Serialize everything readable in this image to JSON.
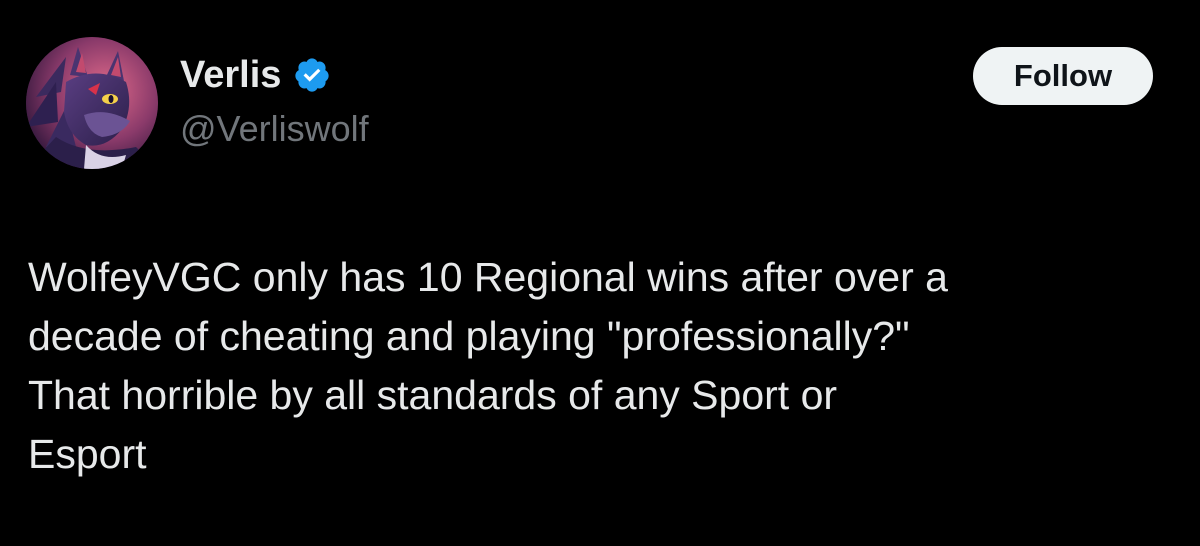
{
  "author": {
    "display_name": "Verlis",
    "handle": "@Verliswolf",
    "verified": true,
    "avatar_icon": "wolf-avatar"
  },
  "actions": {
    "follow_label": "Follow"
  },
  "tweet": {
    "text": "WolfeyVGC only has 10 Regional wins after over a\ndecade of cheating and playing \"professionally?\"\nThat horrible by all standards of any Sport or\nEsport"
  },
  "colors": {
    "background": "#000000",
    "text_primary": "#e7e9ea",
    "text_secondary": "#71767b",
    "verified_blue": "#1d9bf0",
    "follow_bg": "#eff3f4",
    "follow_text": "#0f1419"
  }
}
